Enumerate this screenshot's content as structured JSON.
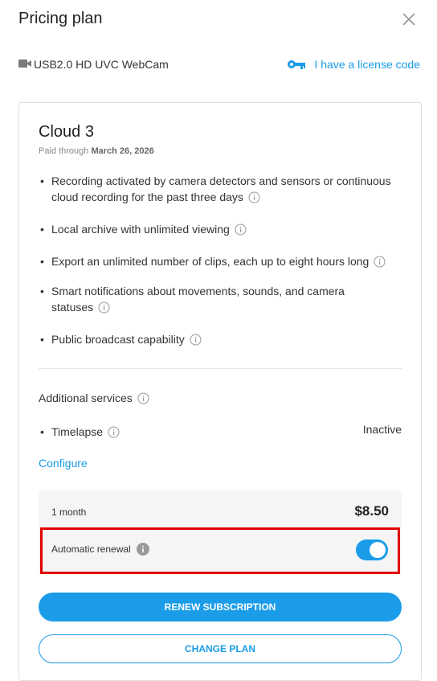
{
  "header": {
    "title": "Pricing plan",
    "close_icon": "close-icon"
  },
  "device": {
    "name": "USB2.0 HD UVC WebCam",
    "icon": "camera-icon",
    "license_link": "I have a license code",
    "license_icon": "key-icon"
  },
  "plan": {
    "name": "Cloud 3",
    "paid_through_prefix": "Paid through ",
    "paid_through_date": "March 26, 2026",
    "features": [
      {
        "line1": "Recording activated by camera detectors and sensors or continuous",
        "line2": "cloud recording for the past three days"
      },
      {
        "line1": "Local archive with unlimited viewing"
      },
      {
        "line1": "Export an unlimited number of clips, each up to eight hours long"
      },
      {
        "line1": "Smart notifications about movements, sounds, and camera",
        "line2": "statuses"
      },
      {
        "line1": "Public broadcast capability"
      }
    ]
  },
  "additional": {
    "title": "Additional services",
    "timelapse_label": "Timelapse",
    "timelapse_status": "Inactive",
    "configure_link": "Configure"
  },
  "billing": {
    "period": "1 month",
    "price": "$8.50",
    "auto_renew_label": "Automatic renewal",
    "auto_renew_on": true
  },
  "actions": {
    "renew": "RENEW SUBSCRIPTION",
    "change": "CHANGE PLAN"
  },
  "colors": {
    "accent": "#1a9ce8",
    "highlight": "#e00000"
  }
}
